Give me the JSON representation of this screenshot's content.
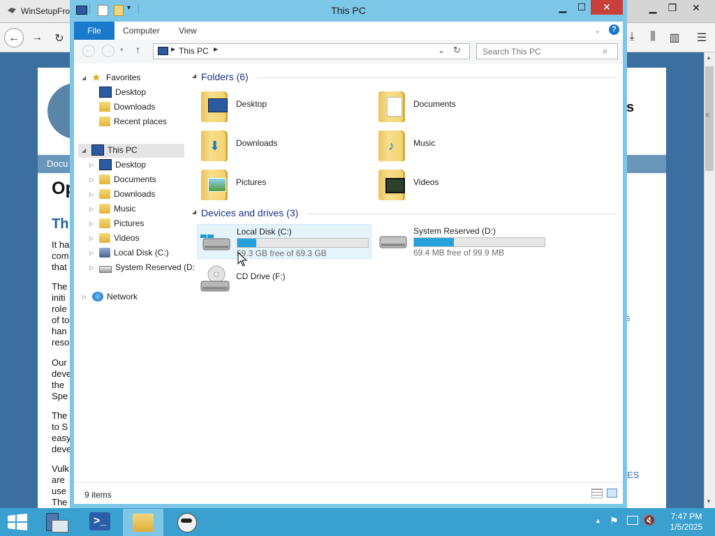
{
  "browser": {
    "tab_title": "WinSetupFro",
    "page_fragments": {
      "band_text": "Docu",
      "heading1": "Op",
      "heading2": "Th",
      "right_heading": "s",
      "right_link1": "s",
      "right_link2": "ES",
      "p1": [
        "It ha",
        "com",
        "that"
      ],
      "p2": [
        "The",
        "initi",
        "role",
        "of to",
        "han",
        "reso"
      ],
      "p3": [
        "Our",
        "deve",
        "the",
        "Spe"
      ],
      "p4": [
        "The",
        "to S",
        "easy",
        "deve"
      ],
      "p5": [
        "Vulk",
        "are",
        "use",
        "The"
      ]
    }
  },
  "explorer": {
    "title": "This PC",
    "ribbon_tabs": {
      "file": "File",
      "computer": "Computer",
      "view": "View"
    },
    "address": {
      "location": "This PC"
    },
    "search": {
      "placeholder": "Search This PC"
    },
    "nav": {
      "favorites": "Favorites",
      "favorites_items": [
        "Desktop",
        "Downloads",
        "Recent places"
      ],
      "this_pc": "This PC",
      "this_pc_items": [
        "Desktop",
        "Documents",
        "Downloads",
        "Music",
        "Pictures",
        "Videos",
        "Local Disk (C:)",
        "System Reserved (D:"
      ],
      "network": "Network"
    },
    "folders": {
      "header": "Folders (6)",
      "items": [
        "Desktop",
        "Documents",
        "Downloads",
        "Music",
        "Pictures",
        "Videos"
      ]
    },
    "devices": {
      "header": "Devices and drives (3)",
      "drives": [
        {
          "label": "Local Disk (C:)",
          "free_text": "59.3 GB free of 69.3 GB",
          "used_fraction": 0.144
        },
        {
          "label": "System Reserved (D:)",
          "free_text": "69.4 MB free of 99.9 MB",
          "used_fraction": 0.305
        },
        {
          "label": "CD Drive (F:)"
        }
      ]
    },
    "status": {
      "items": "9 items"
    }
  },
  "taskbar": {
    "time": "7:47 PM",
    "date": "1/5/2025"
  },
  "colors": {
    "accent": "#1979ca",
    "drive_bar": "#26a0da",
    "window_frame": "#7cc6e8",
    "taskbar": "#3aa0d0",
    "group_header": "#1e3287"
  }
}
